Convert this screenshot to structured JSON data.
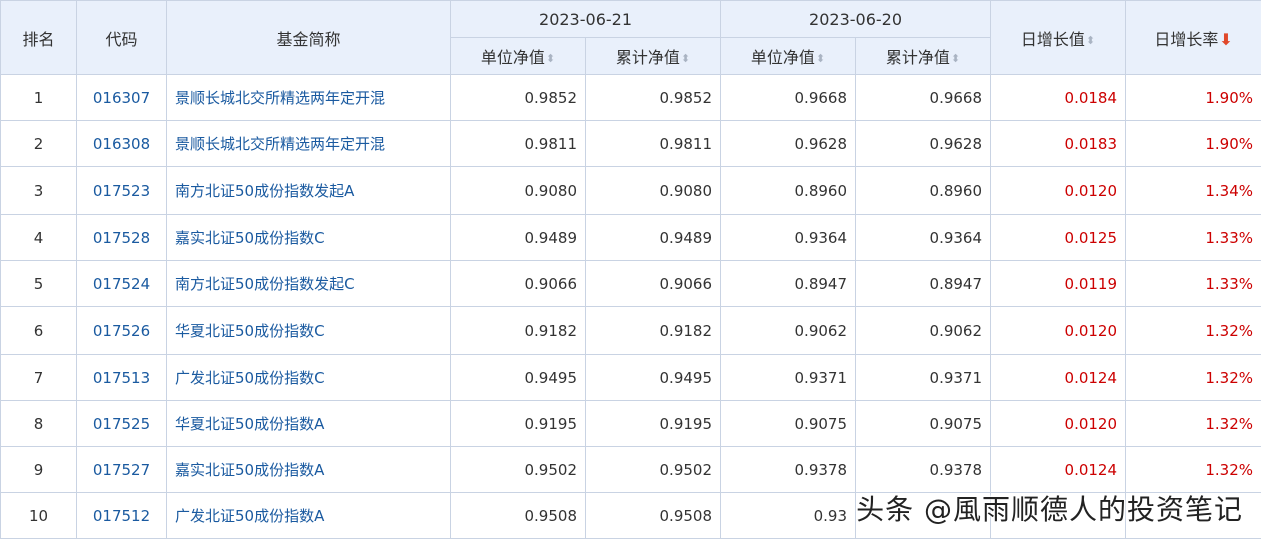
{
  "header": {
    "rank": "排名",
    "code": "代码",
    "name": "基金简称",
    "date1": "2023-06-21",
    "date2": "2023-06-20",
    "unit_nav": "单位净值",
    "acc_nav": "累计净值",
    "daily_change": "日增长值",
    "daily_rate": "日增长率"
  },
  "rows": [
    {
      "rank": "1",
      "code": "016307",
      "name": "景顺长城北交所精选两年定开混",
      "u1": "0.9852",
      "a1": "0.9852",
      "u2": "0.9668",
      "a2": "0.9668",
      "chg": "0.0184",
      "rate": "1.90%"
    },
    {
      "rank": "2",
      "code": "016308",
      "name": "景顺长城北交所精选两年定开混",
      "u1": "0.9811",
      "a1": "0.9811",
      "u2": "0.9628",
      "a2": "0.9628",
      "chg": "0.0183",
      "rate": "1.90%"
    },
    {
      "rank": "3",
      "code": "017523",
      "name": "南方北证50成份指数发起A",
      "u1": "0.9080",
      "a1": "0.9080",
      "u2": "0.8960",
      "a2": "0.8960",
      "chg": "0.0120",
      "rate": "1.34%"
    },
    {
      "rank": "4",
      "code": "017528",
      "name": "嘉实北证50成份指数C",
      "u1": "0.9489",
      "a1": "0.9489",
      "u2": "0.9364",
      "a2": "0.9364",
      "chg": "0.0125",
      "rate": "1.33%"
    },
    {
      "rank": "5",
      "code": "017524",
      "name": "南方北证50成份指数发起C",
      "u1": "0.9066",
      "a1": "0.9066",
      "u2": "0.8947",
      "a2": "0.8947",
      "chg": "0.0119",
      "rate": "1.33%"
    },
    {
      "rank": "6",
      "code": "017526",
      "name": "华夏北证50成份指数C",
      "u1": "0.9182",
      "a1": "0.9182",
      "u2": "0.9062",
      "a2": "0.9062",
      "chg": "0.0120",
      "rate": "1.32%"
    },
    {
      "rank": "7",
      "code": "017513",
      "name": "广发北证50成份指数C",
      "u1": "0.9495",
      "a1": "0.9495",
      "u2": "0.9371",
      "a2": "0.9371",
      "chg": "0.0124",
      "rate": "1.32%"
    },
    {
      "rank": "8",
      "code": "017525",
      "name": "华夏北证50成份指数A",
      "u1": "0.9195",
      "a1": "0.9195",
      "u2": "0.9075",
      "a2": "0.9075",
      "chg": "0.0120",
      "rate": "1.32%"
    },
    {
      "rank": "9",
      "code": "017527",
      "name": "嘉实北证50成份指数A",
      "u1": "0.9502",
      "a1": "0.9502",
      "u2": "0.9378",
      "a2": "0.9378",
      "chg": "0.0124",
      "rate": "1.32%"
    },
    {
      "rank": "10",
      "code": "017512",
      "name": "广发北证50成份指数A",
      "u1": "0.9508",
      "a1": "0.9508",
      "u2": "0.93",
      "a2": "",
      "chg": "",
      "rate": ""
    }
  ],
  "watermark": "头条 @風雨顺德人的投资笔记",
  "icons": {
    "sort": "sort-updown-icon",
    "sort_active": "arrow-down-icon"
  },
  "colors": {
    "header_bg": "#e9f0fb",
    "link": "#1a5aa0",
    "positive": "#cc0000",
    "border": "#c9d3e3"
  }
}
